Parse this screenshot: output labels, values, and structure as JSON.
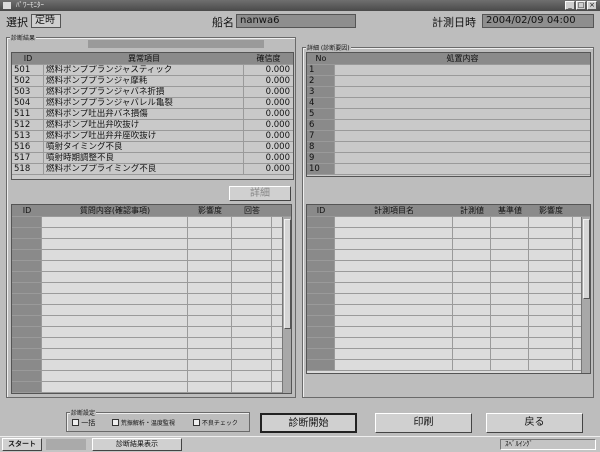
{
  "window": {
    "title": "ﾊﾟﾜｰﾓﾆﾀｰ"
  },
  "header": {
    "select_label": "選択",
    "select_value": "定時",
    "ship_label": "船名",
    "ship_value": "nanwa6",
    "datetime_label": "計測日時",
    "datetime_value": "2004/02/09 04:00"
  },
  "result_group": {
    "title": "診断結果",
    "columns": [
      "ID",
      "異常項目",
      "確信度"
    ],
    "rows": [
      {
        "id": "501",
        "name": "燃料ポンププランジャスティック",
        "value": "0.000"
      },
      {
        "id": "502",
        "name": "燃料ポンププランジャ摩耗",
        "value": "0.000"
      },
      {
        "id": "503",
        "name": "燃料ポンププランジャバネ折損",
        "value": "0.000"
      },
      {
        "id": "504",
        "name": "燃料ポンププランジャバレル亀裂",
        "value": "0.000"
      },
      {
        "id": "511",
        "name": "燃料ポンプ吐出弁バネ損傷",
        "value": "0.000"
      },
      {
        "id": "512",
        "name": "燃料ポンプ吐出弁吹抜け",
        "value": "0.000"
      },
      {
        "id": "513",
        "name": "燃料ポンプ吐出弁弁座吹抜け",
        "value": "0.000"
      },
      {
        "id": "516",
        "name": "噴射タイミング不良",
        "value": "0.000"
      },
      {
        "id": "517",
        "name": "噴射時期調整不良",
        "value": "0.000"
      },
      {
        "id": "518",
        "name": "燃料ポンププライミング不良",
        "value": "0.000"
      }
    ],
    "detail_button": "詳細",
    "measure_columns": [
      "ID",
      "質問内容(確認事項)",
      "影響度",
      "回答"
    ]
  },
  "detail_group": {
    "title": "詳細 (診断要因)",
    "columns": [
      "No",
      "処置内容"
    ],
    "rows": [
      "1",
      "2",
      "3",
      "4",
      "5",
      "6",
      "7",
      "8",
      "9",
      "10"
    ],
    "measure_columns": [
      "ID",
      "計測項目名",
      "計測値",
      "基準値",
      "影響度"
    ]
  },
  "settings": {
    "title": "診断設定",
    "option_all": "一括",
    "option_analysis": "荒振解析・温度監視",
    "option_check": "不良チェック"
  },
  "buttons": {
    "start": "診断開始",
    "print": "印刷",
    "back": "戻る"
  },
  "taskbar": {
    "start": "スタート",
    "task": "診断結果表示",
    "tray": "ｽﾍﾞﾙｲﾝｸﾞ"
  }
}
